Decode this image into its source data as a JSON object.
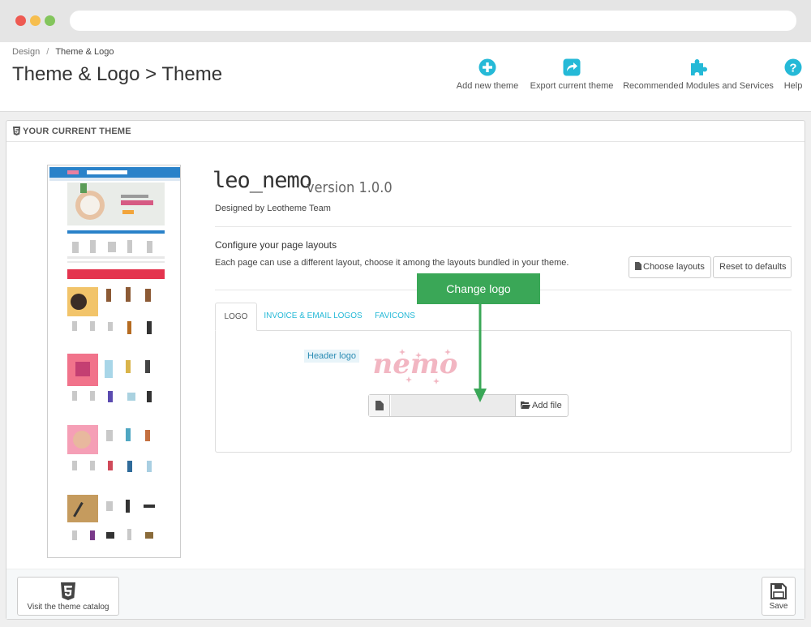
{
  "breadcrumb": {
    "parent": "Design",
    "separator": "/",
    "current": "Theme & Logo"
  },
  "page_title": "Theme & Logo > Theme",
  "toolbar": {
    "add_new_theme": "Add new theme",
    "export_current_theme": "Export current theme",
    "recommended_modules": "Recommended Modules and Services",
    "help": "Help"
  },
  "panel": {
    "heading": "YOUR CURRENT THEME"
  },
  "theme": {
    "name": "leo_nemo",
    "version": "version 1.0.0",
    "designed_by": "Designed by Leotheme Team"
  },
  "configure": {
    "title": "Configure your page layouts",
    "description": "Each page can use a different layout, choose it among the layouts bundled in your theme.",
    "choose_layouts": "Choose layouts",
    "reset_defaults": "Reset to defaults"
  },
  "tabs": [
    {
      "label": "LOGO",
      "active": true
    },
    {
      "label": "INVOICE & EMAIL LOGOS",
      "active": false
    },
    {
      "label": "FAVICONS",
      "active": false
    }
  ],
  "logo_tab": {
    "header_logo_label": "Header logo",
    "logo_text": "nemo",
    "add_file": "Add file"
  },
  "annotation": {
    "callout": "Change logo"
  },
  "footer": {
    "visit_catalog": "Visit the theme catalog",
    "save": "Save"
  },
  "colors": {
    "accent": "#25b9d7",
    "callout": "#3aa757",
    "logo_pink": "#f2b6c2"
  }
}
